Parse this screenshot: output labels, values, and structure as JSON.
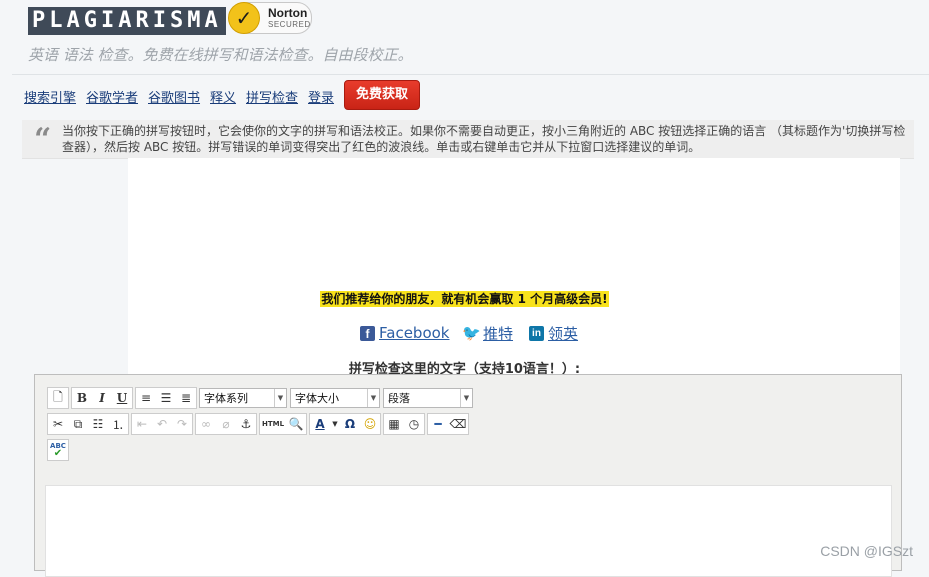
{
  "header": {
    "logo": "PLAGIARISMA",
    "norton_brand": "Norton",
    "norton_secured": "SECURED",
    "tagline": "英语 语法 检查。免费在线拼写和语法检查。自由段校正。"
  },
  "nav": {
    "links": [
      "搜索引擎",
      "谷歌学者",
      "谷歌图书",
      "释义",
      "拼写检查",
      "登录"
    ],
    "cta": "免费获取"
  },
  "info": {
    "quote_icon": "quote-icon",
    "text": "当你按下正确的拼写按钮时，它会使你的文字的拼写和语法校正。如果你不需要自动更正，按小三角附近的 ABC 按钮选择正确的语言 （其标题作为'切换拼写检查器），然后按 ABC 按钮。拼写错误的单词变得突出了红色的波浪线。单击或右键单击它并从下拉窗口选择建议的单词。"
  },
  "promo": "我们推荐给你的朋友，就有机会赢取 1 个月高级会员!",
  "social": {
    "facebook": "Facebook",
    "twitter": "推特",
    "linkedin": "领英"
  },
  "check_label": "拼写检查这里的文字（支持10语言！）:",
  "editor": {
    "font_family": "字体系列",
    "font_size": "字体大小",
    "paragraph": "段落",
    "bold": "B",
    "italic": "I",
    "underline": "U",
    "html_label": "HTML",
    "spell_label": "ABC"
  },
  "watermark": "CSDN @IGSzt",
  "colors": {
    "cta": "#d9301f",
    "promo_highlight": "#f8e21c",
    "link": "#2c5ea4"
  }
}
